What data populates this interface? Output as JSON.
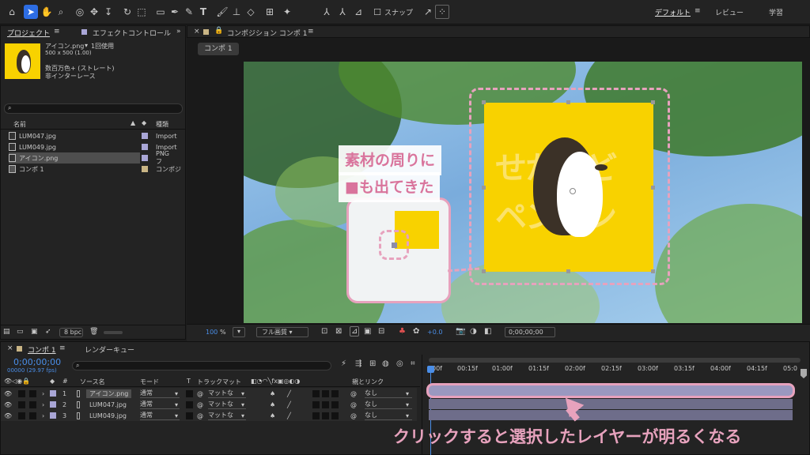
{
  "toolbar": {
    "snap_label": "スナップ",
    "workspaces": [
      "デフォルト",
      "レビュー",
      "学習"
    ]
  },
  "project": {
    "tab_project": "プロジェクト",
    "tab_effects": "エフェクトコントロール",
    "asset_name": "アイコン.png",
    "asset_usage": "1回使用",
    "asset_dims": "500 x 500 (1.00)",
    "asset_color": "数百万色+ (ストレート)",
    "asset_scan": "非インターレース",
    "col_name": "名前",
    "col_type": "種類",
    "items": [
      {
        "name": "LUM047.jpg",
        "type": "Import",
        "color": "#a9a6d6"
      },
      {
        "name": "LUM049.jpg",
        "type": "Import",
        "color": "#a9a6d6"
      },
      {
        "name": "アイコン.png",
        "type": "PNG フ",
        "color": "#a9a6d6"
      },
      {
        "name": "コンポ 1",
        "type": "コンポジ",
        "color": "#c9b585"
      }
    ],
    "bpc": "8 bpc"
  },
  "viewer": {
    "tab_title": "コンポジション コンポ 1",
    "comp_tab": "コンポ 1",
    "zoom": "100",
    "zoom_unit": "%",
    "quality": "フル画質",
    "exposure": "+0.0",
    "timecode": "0;00;00;00"
  },
  "artwork": {
    "callout_line1": "素材の周りに",
    "callout_line2": "■も出てきた",
    "logo_top": "せかいど",
    "logo_bottom": "ペンギン"
  },
  "timeline": {
    "tab_comp": "コンポ 1",
    "tab_render": "レンダーキュー",
    "timecode": "0;00;00;00",
    "frames": "00000 (29.97 fps)",
    "col_source": "ソース名",
    "col_mode": "モード",
    "col_t": "T",
    "col_track": "トラックマット",
    "col_parent": "親とリンク",
    "ruler": [
      "00f",
      "00:15f",
      "01:00f",
      "01:15f",
      "02:00f",
      "02:15f",
      "03:00f",
      "03:15f",
      "04:00f",
      "04:15f",
      "05:0"
    ],
    "layers": [
      {
        "num": "1",
        "name": "アイコン.png",
        "mode": "通常",
        "track": "マットな",
        "parent": "なし",
        "color": "#a9a6d6"
      },
      {
        "num": "2",
        "name": "LUM047.jpg",
        "mode": "通常",
        "track": "マットな",
        "parent": "なし",
        "color": "#a9a6d6"
      },
      {
        "num": "3",
        "name": "LUM049.jpg",
        "mode": "通常",
        "track": "マットな",
        "parent": "なし",
        "color": "#a9a6d6"
      }
    ],
    "annotation": "クリックすると選択したレイヤーが明るくなる"
  },
  "colors": {
    "accent_blue": "#2d6de3",
    "timecode_blue": "#4a8ee8",
    "pink": "#d9749c",
    "yellow": "#f8d200"
  }
}
